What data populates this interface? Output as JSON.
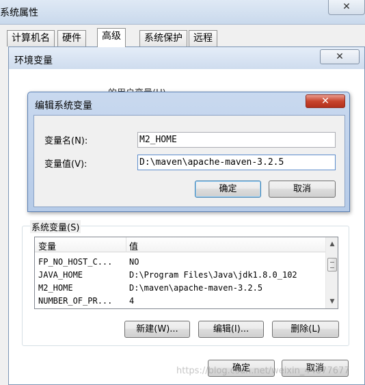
{
  "system_properties": {
    "title": "系统属性",
    "close": "✕",
    "tabs": [
      {
        "label": "计算机名"
      },
      {
        "label": "硬件"
      },
      {
        "label": "高级",
        "active": true
      },
      {
        "label": "系统保护"
      },
      {
        "label": "远程"
      }
    ]
  },
  "env_dialog": {
    "title": "环境变量",
    "close": "✕",
    "user_vars_label": "的用户变量(U)",
    "system_vars_label": "系统变量(S)",
    "columns": [
      "变量",
      "值"
    ],
    "rows": [
      {
        "name": "FP_NO_HOST_C...",
        "value": "NO"
      },
      {
        "name": "JAVA_HOME",
        "value": "D:\\Program Files\\Java\\jdk1.8.0_102"
      },
      {
        "name": "M2_HOME",
        "value": "D:\\maven\\apache-maven-3.2.5"
      },
      {
        "name": "NUMBER_OF_PR...",
        "value": "4"
      }
    ],
    "buttons": {
      "new": "新建(W)...",
      "edit": "编辑(I)...",
      "delete": "删除(L)",
      "ok": "确定",
      "cancel": "取消"
    }
  },
  "edit_dialog": {
    "title": "编辑系统变量",
    "close": "✕",
    "name_label": "变量名(N):",
    "name_value": "M2_HOME",
    "value_label": "变量值(V):",
    "value_value": "D:\\maven\\apache-maven-3.2.5",
    "ok": "确定",
    "cancel": "取消"
  },
  "watermark": "https://blog.csdn.net/weixin_44877677"
}
